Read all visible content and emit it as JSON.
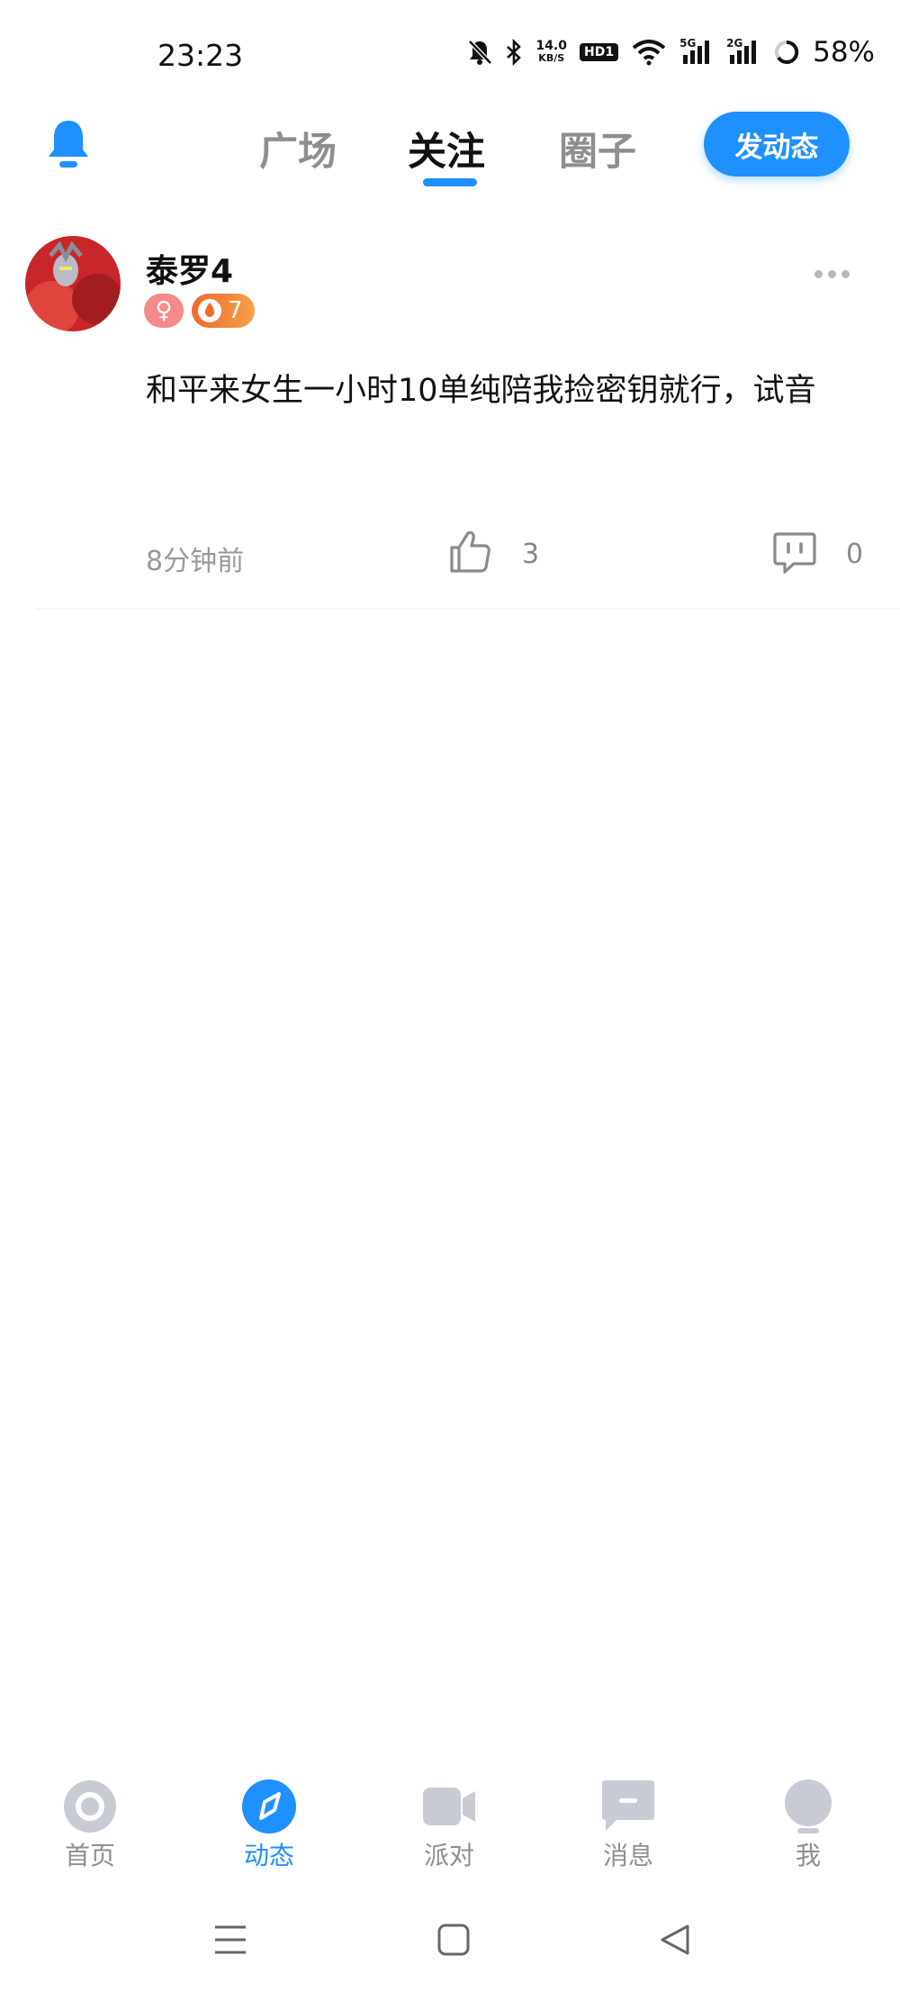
{
  "status_bar": {
    "time": "23:23",
    "net_speed_value": "14.0",
    "net_speed_unit": "KB/S",
    "hd_label": "HD1",
    "sim1_label": "5G",
    "sim2_label": "2G",
    "battery_percent": "58%"
  },
  "header": {
    "tabs": [
      {
        "label": "广场"
      },
      {
        "label": "关注"
      },
      {
        "label": "圈子"
      }
    ],
    "post_button": "发动态",
    "accent_color": "#1e90ff"
  },
  "post": {
    "username": "泰罗4",
    "gender_symbol": "♀",
    "level": "7",
    "content": "和平来女生一小时10单纯陪我捡密钥就行，试音",
    "timestamp": "8分钟前",
    "like_count": "3",
    "comment_count": "0"
  },
  "bottom_nav": {
    "items": [
      {
        "label": "首页",
        "icon": "home-icon"
      },
      {
        "label": "动态",
        "icon": "compass-icon"
      },
      {
        "label": "派对",
        "icon": "video-camera-icon"
      },
      {
        "label": "消息",
        "icon": "message-icon"
      },
      {
        "label": "我",
        "icon": "profile-icon"
      }
    ],
    "active_index": 1
  }
}
